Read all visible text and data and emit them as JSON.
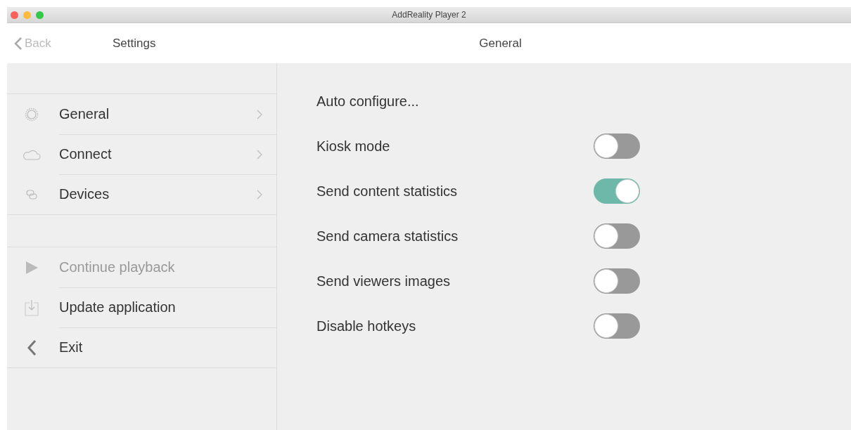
{
  "window": {
    "title": "AddReality Player 2"
  },
  "header": {
    "back": "Back",
    "left_title": "Settings",
    "right_title": "General"
  },
  "sidebar": {
    "groups": [
      {
        "items": [
          {
            "label": "General",
            "kind": "submenu",
            "disabled": false
          },
          {
            "label": "Connect",
            "kind": "submenu",
            "disabled": false
          },
          {
            "label": "Devices",
            "kind": "submenu",
            "disabled": false
          }
        ]
      },
      {
        "items": [
          {
            "label": "Continue playback",
            "kind": "action",
            "disabled": true
          },
          {
            "label": "Update application",
            "kind": "action",
            "disabled": false
          },
          {
            "label": "Exit",
            "kind": "action",
            "disabled": false
          }
        ]
      }
    ]
  },
  "settings": [
    {
      "label": "Auto configure...",
      "kind": "action"
    },
    {
      "label": "Kiosk mode",
      "kind": "toggle",
      "on": false
    },
    {
      "label": "Send content statistics",
      "kind": "toggle",
      "on": true
    },
    {
      "label": "Send camera statistics",
      "kind": "toggle",
      "on": false
    },
    {
      "label": "Send viewers images",
      "kind": "toggle",
      "on": false
    },
    {
      "label": "Disable hotkeys",
      "kind": "toggle",
      "on": false
    }
  ]
}
